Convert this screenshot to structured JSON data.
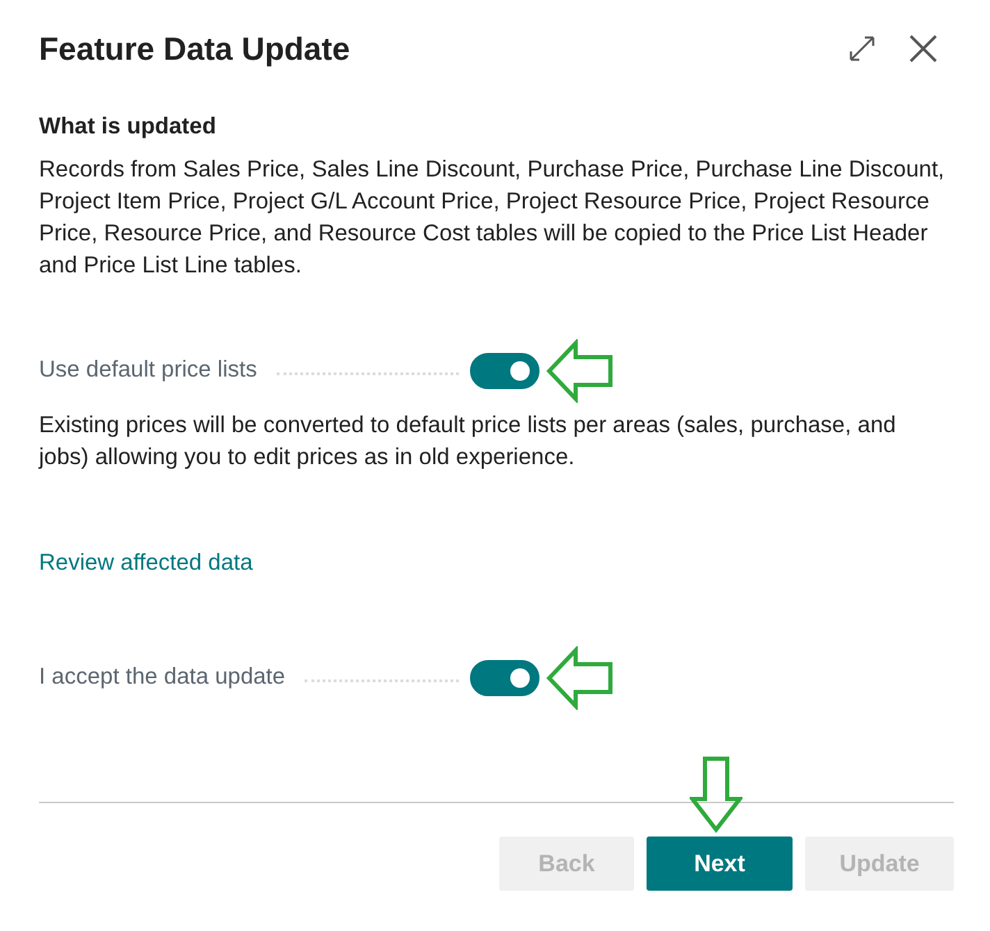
{
  "window": {
    "title": "Feature Data Update"
  },
  "section": {
    "heading": "What is updated",
    "description": "Records from Sales Price, Sales Line Discount, Purchase Price, Purchase Line Discount, Project Item Price, Project G/L Account Price, Project Resource Price, Project Resource Price, Resource Price, and Resource Cost tables will be copied to the Price List Header and Price List Line tables."
  },
  "settings": [
    {
      "kind": "toggle",
      "label": "Use default price lists",
      "on": true,
      "arrow": true,
      "note": "Existing prices will be converted to default price lists per areas (sales, purchase, and jobs) allowing you to edit prices as in old experience."
    },
    {
      "kind": "link",
      "label": "Review affected data"
    },
    {
      "kind": "toggle",
      "label": "I accept the data update",
      "on": true,
      "arrow": true
    }
  ],
  "buttons": [
    {
      "label": "Back",
      "disabled": true,
      "arrow": false
    },
    {
      "label": "Next",
      "disabled": false,
      "arrow": true
    },
    {
      "label": "Update",
      "disabled": true,
      "arrow": false
    }
  ]
}
